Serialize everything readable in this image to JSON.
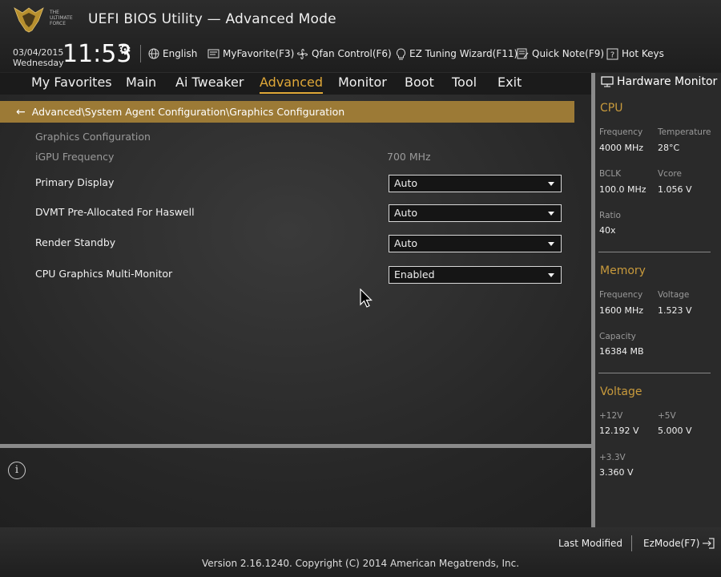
{
  "logo": {
    "text": "THE ULTIMATE FORCE"
  },
  "header": {
    "title": "UEFI BIOS Utility — Advanced Mode",
    "date": "03/04/2015",
    "weekday": "Wednesday",
    "time": "11:53"
  },
  "toolbar": {
    "language": "English",
    "myfavorite": "MyFavorite(F3)",
    "qfan": "Qfan Control(F6)",
    "ez_tuning": "EZ Tuning Wizard(F11)",
    "quick_note": "Quick Note(F9)",
    "hot_keys": "Hot Keys"
  },
  "menu": {
    "items": [
      "My Favorites",
      "Main",
      "Ai Tweaker",
      "Advanced",
      "Monitor",
      "Boot",
      "Tool",
      "Exit"
    ],
    "active": "Advanced"
  },
  "breadcrumb": "Advanced\\System Agent Configuration\\Graphics Configuration",
  "settings": {
    "section_title": "Graphics Configuration",
    "igpu_label": "iGPU Frequency",
    "igpu_value": "700 MHz",
    "rows": [
      {
        "label": "Primary Display",
        "value": "Auto"
      },
      {
        "label": "DVMT Pre-Allocated For Haswell",
        "value": "Auto"
      },
      {
        "label": "Render Standby",
        "value": "Auto"
      },
      {
        "label": "CPU Graphics Multi-Monitor",
        "value": "Enabled"
      }
    ]
  },
  "hw": {
    "title": "Hardware Monitor",
    "cpu": {
      "title": "CPU",
      "freq_label": "Frequency",
      "freq": "4000 MHz",
      "temp_label": "Temperature",
      "temp": "28°C",
      "bclk_label": "BCLK",
      "bclk": "100.0 MHz",
      "vcore_label": "Vcore",
      "vcore": "1.056 V",
      "ratio_label": "Ratio",
      "ratio": "40x"
    },
    "memory": {
      "title": "Memory",
      "freq_label": "Frequency",
      "freq": "1600 MHz",
      "volt_label": "Voltage",
      "volt": "1.523 V",
      "cap_label": "Capacity",
      "cap": "16384 MB"
    },
    "voltage": {
      "title": "Voltage",
      "v12_label": "+12V",
      "v12": "12.192 V",
      "v5_label": "+5V",
      "v5": "5.000 V",
      "v33_label": "+3.3V",
      "v33": "3.360 V"
    }
  },
  "footer": {
    "last_modified": "Last Modified",
    "ezmode": "EzMode(F7)",
    "version": "Version 2.16.1240. Copyright (C) 2014 American Megatrends, Inc."
  },
  "colors": {
    "accent": "#e0a838",
    "breadcrumb_bg": "#9c7a36",
    "hw_section": "#c89a3c"
  }
}
